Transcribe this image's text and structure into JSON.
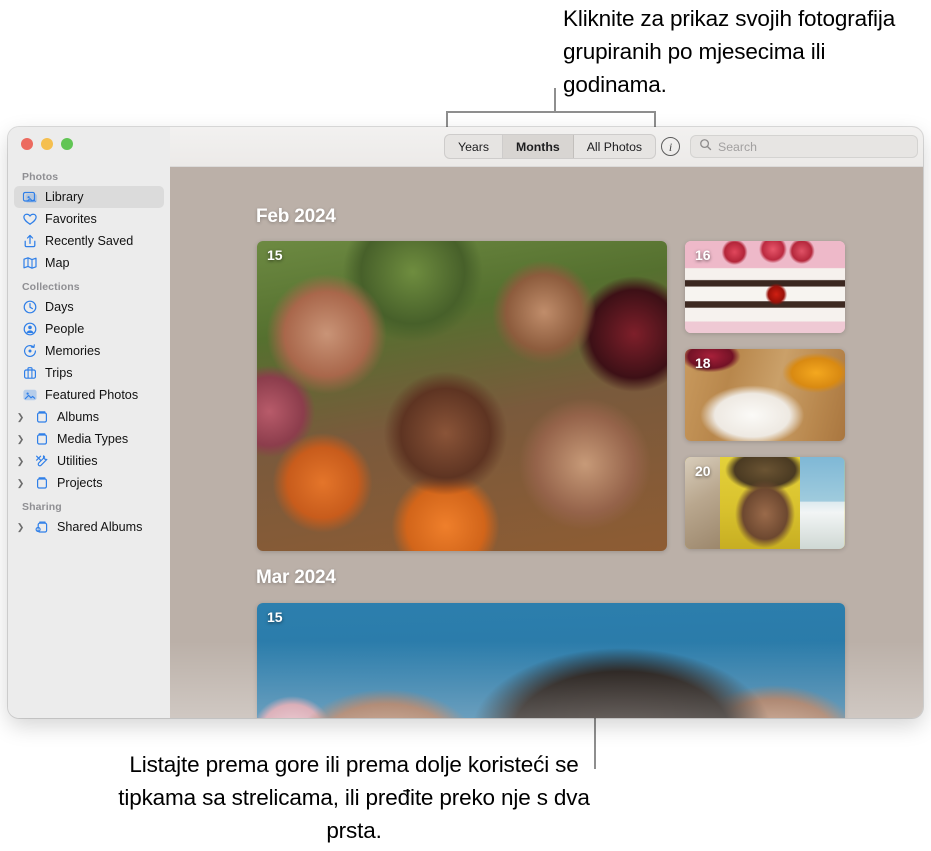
{
  "callouts": {
    "top": "Kliknite za prikaz svojih fotografija grupiranih po mjesecima ili godinama.",
    "bottom": "Listajte prema gore ili prema dolje koristeći se tipkama sa strelicama, ili pređite preko nje s dva prsta."
  },
  "window": {
    "traffic_lights": {
      "close": "close-button",
      "minimize": "minimize-button",
      "zoom": "zoom-button"
    }
  },
  "sidebar": {
    "sections": [
      {
        "title": "Photos",
        "items": [
          {
            "label": "Library",
            "icon": "library-icon",
            "selected": true,
            "disclosure": false
          },
          {
            "label": "Favorites",
            "icon": "heart-icon",
            "selected": false,
            "disclosure": false
          },
          {
            "label": "Recently Saved",
            "icon": "recently-saved-icon",
            "selected": false,
            "disclosure": false
          },
          {
            "label": "Map",
            "icon": "map-icon",
            "selected": false,
            "disclosure": false
          }
        ]
      },
      {
        "title": "Collections",
        "items": [
          {
            "label": "Days",
            "icon": "clock-icon",
            "selected": false,
            "disclosure": false
          },
          {
            "label": "People",
            "icon": "person-icon",
            "selected": false,
            "disclosure": false
          },
          {
            "label": "Memories",
            "icon": "memories-icon",
            "selected": false,
            "disclosure": false
          },
          {
            "label": "Trips",
            "icon": "suitcase-icon",
            "selected": false,
            "disclosure": false
          },
          {
            "label": "Featured Photos",
            "icon": "featured-photos-icon",
            "selected": false,
            "disclosure": false
          },
          {
            "label": "Albums",
            "icon": "album-icon",
            "selected": false,
            "disclosure": true
          },
          {
            "label": "Media Types",
            "icon": "album-icon",
            "selected": false,
            "disclosure": true
          },
          {
            "label": "Utilities",
            "icon": "utilities-icon",
            "selected": false,
            "disclosure": true
          },
          {
            "label": "Projects",
            "icon": "album-icon",
            "selected": false,
            "disclosure": true
          }
        ]
      },
      {
        "title": "Sharing",
        "items": [
          {
            "label": "Shared Albums",
            "icon": "shared-album-icon",
            "selected": false,
            "disclosure": true
          }
        ]
      }
    ],
    "disclosure_glyph": "❯"
  },
  "toolbar": {
    "segments": [
      {
        "label": "Years",
        "active": false
      },
      {
        "label": "Months",
        "active": true
      },
      {
        "label": "All Photos",
        "active": false
      }
    ],
    "info_button": {
      "icon": "info-icon",
      "glyph": "i"
    },
    "search": {
      "icon": "search-icon",
      "placeholder": "Search",
      "value": ""
    }
  },
  "library": {
    "months": [
      {
        "header": "Feb 2024",
        "tiles": [
          {
            "day": "15",
            "art": "art-selfie",
            "name": "photo-tile-feb-15"
          },
          {
            "day": "16",
            "art": "art-cake",
            "name": "photo-tile-feb-16"
          },
          {
            "day": "18",
            "art": "art-food",
            "name": "photo-tile-feb-18"
          },
          {
            "day": "20",
            "art": "art-portrait",
            "name": "photo-tile-feb-20"
          }
        ]
      },
      {
        "header": "Mar 2024",
        "tiles": [
          {
            "day": "15",
            "art": "art-blueportrait",
            "name": "photo-tile-mar-15"
          }
        ]
      }
    ]
  },
  "colors": {
    "selected_row": "#dbdbdb",
    "sidebar_bg": "#ececec",
    "accent_blue": "#2f7fe8",
    "section_header": "#8f8f93",
    "leader_line": "#8e8e8e",
    "traffic_close": "#ec6a5f",
    "traffic_minimize": "#f5bf4f",
    "traffic_zoom": "#61c554"
  }
}
